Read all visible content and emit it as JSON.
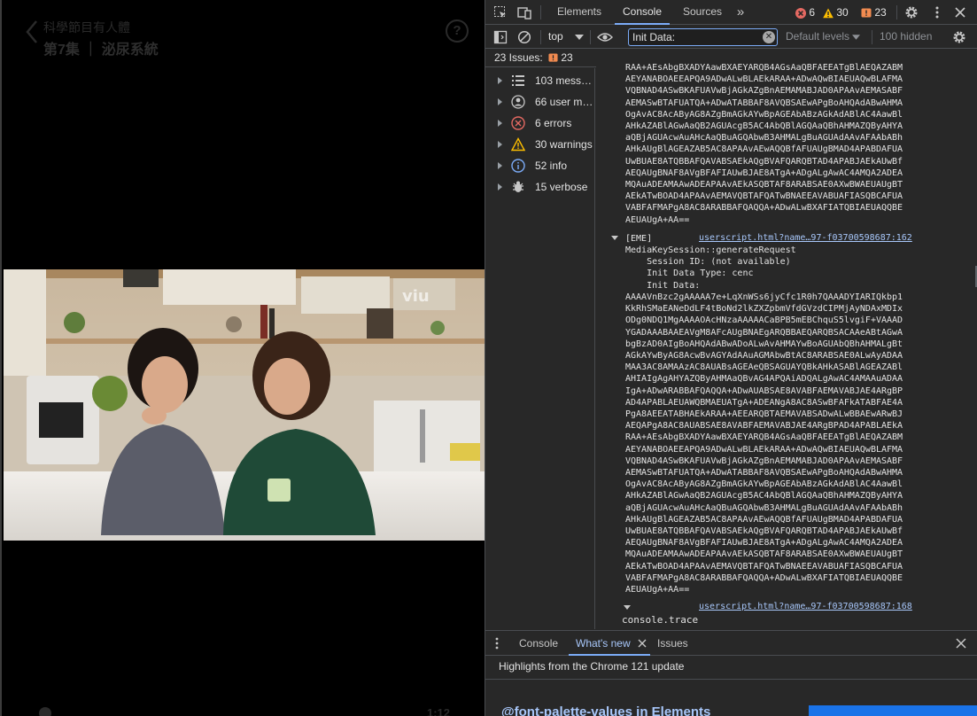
{
  "player": {
    "show_title": "科學節目有人體",
    "episode_title": "第7集 ｜ 泌尿系統",
    "help_label": "?",
    "watermark": "viu",
    "time": "1:12"
  },
  "devtools": {
    "tabs": [
      "Elements",
      "Console",
      "Sources"
    ],
    "more_tabs": "»",
    "counts": {
      "errors": "6",
      "warnings": "30",
      "issues": "23"
    },
    "toolbar": {
      "context": "top",
      "filter_value": "Init Data:",
      "levels": "Default levels",
      "hidden": "100 hidden"
    },
    "issues_bar": {
      "label": "23 Issues:",
      "count": "23"
    },
    "sidebar": [
      {
        "label": "103 messa…",
        "icon": "list-icon"
      },
      {
        "label": "66 user me…",
        "icon": "user-icon"
      },
      {
        "label": "6 errors",
        "icon": "error-icon"
      },
      {
        "label": "30 warnings",
        "icon": "warning-icon"
      },
      {
        "label": "52 info",
        "icon": "info-icon"
      },
      {
        "label": "15 verbose",
        "icon": "bug-icon"
      }
    ],
    "console": {
      "prev_b64": "RAA+AEsAbgBXADYAawBXAEYARQB4AGsAaQBFAEEATgBlAEQAZABM\nAEYANABOAEEAPQA9ADwALwBLAEkARAA+ADwAQwBIAEUAQwBLAFMA\nVQBNAD4ASwBKAFUAVwBjAGkAZgBnAEMAMABJAD0APAAvAEMASABF\nAEMASwBTAFUATQA+ADwATABBAF8AVQBSAEwAPgBoAHQAdABwAHMA\nOgAvAC8AcAByAG8AZgBmAGkAYwBpAGEAbABzAGkAdABlAC4AawBl\nAHkAZABlAGwAaQB2AGUAcgB5AC4AbQBlAGQAaQBhAHMAZQByAHYA\naQBjAGUAcwAuAHcAaQBuAGQAbwB3AHMALgBuAGUAdAAvAFAAbABh\nAHkAUgBlAGEAZAB5AC8APAAvAEwAQQBfAFUAUgBMAD4APABDAFUA\nUwBUAE8ATQBBAFQAVABSAEkAQgBVAFQARQBTAD4APABJAEkAUwBf\nAEQAUgBNAF8AVgBFAFIAUwBJAE8ATgA+ADgALgAwAC4AMQA2ADEA\nMQAuADEAMAAwADEAPAAvAEkASQBTAF8ARABSAE0AXwBWAEUAUgBT\nAEkATwBOAD4APAAvAEMAVQBTAFQATwBNAEEAVABUAFIASQBCAFUA\nVABFAFMAPgA8AC8ARABBAFQAQQA+ADwALwBXAFIATQBIAEUAQQBE\nAEUAUgA+AA==",
      "eme_tag": "[EME]",
      "link1": "userscript.html?name…97-f03700598687:162",
      "eme_lines": "MediaKeySession::generateRequest\n    Session ID: (not available)\n    Init Data Type: cenc\n    Init Data:",
      "init_b64": "AAAAVnBzc2gAAAAA7e+LqXnWSs6jyCfc1R0h7QAAADYIARIQkbp1\nKkRhSMaEANeDdLF4tBoNd2lkZXZpbmVfdGVzdCIPMjAyNDAxMDIx\nODg0NDQ1MgAAAAOAcHNzaAAAAACaBPB5mEBChquS5lvgiF+VAAAD\nYGADAAABAAEAVgM8AFcAUgBNAEgARQBBAEQARQBSACAAeABtAGwA\nbgBzAD0AIgBoAHQAdABwADoALwAvAHMAYwBoAGUAbQBhAHMALgBt\nAGkAYwByAG8AcwBvAGYAdAAuAGMAbwBtAC8ARABSAE0ALwAyADAA\nMAA3AC8AMAAzAC8AUABsAGEAeQBSAGUAYQBkAHkASABlAGEAZABl\nAHIAIgAgAHYAZQByAHMAaQBvAG4APQAiADQALgAwAC4AMAAuADAA\nIgA+ADwARABBAFQAQQA+ADwAUABSAE8AVABFAEMAVABJAE4ARgBP\nAD4APABLAEUAWQBMAEUATgA+ADEANgA8AC8ASwBFAFkATABFAE4A\nPgA8AEEATABHAEkARAA+AEEARQBTAEMAVABSADwALwBBAEwARwBJ\nAEQAPgA8AC8AUABSAE8AVABFAEMAVABJAE4ARgBPAD4APABLAEkA\nRAA+AEsAbgBXADYAawBXAEYARQB4AGsAaQBFAEEATgBlAEQAZABM\nAEYANABOAEEAPQA9ADwALwBLAEkARAA+ADwAQwBIAEUAQwBLAFMA\nVQBNAD4ASwBKAFUAVwBjAGkAZgBnAEMAMABJAD0APAAvAEMASABF\nAEMASwBTAFUATQA+ADwATABBAF8AVQBSAEwAPgBoAHQAdABwAHMA\nOgAvAC8AcAByAG8AZgBmAGkAYwBpAGEAbABzAGkAdABlAC4AawBl\nAHkAZABlAGwAaQB2AGUAcgB5AC4AbQBlAGQAaQBhAHMAZQByAHYA\naQBjAGUAcwAuAHcAaQBuAGQAbwB3AHMALgBuAGUAdAAvAFAAbABh\nAHkAUgBlAGEAZAB5AC8APAAvAEwAQQBfAFUAUgBMAD4APABDAFUA\nUwBUAE8ATQBBAFQAVABSAEkAQgBVAFQARQBTAD4APABJAEkAUwBf\nAEQAUgBNAF8AVgBFAFIAUwBJAE8ATgA+ADgALgAwAC4AMQA2ADEA\nMQAuADEAMAAwADEAPAAvAEkASQBTAF8ARABSAE0AXwBWAEUAUgBT\nAEkATwBOAD4APAAvAEMAVQBTAFQATwBNAEEAVABUAFIASQBCAFUA\nVABFAFMAPgA8AC8ARABBAFQAQQA+ADwALwBXAFIATQBIAEUAQQBE\nAEUAUgA+AA==",
      "link2": "userscript.html?name…97-f03700598687:168",
      "trace": "console.trace"
    },
    "drawer": {
      "tabs": [
        "Console",
        "What's new",
        "Issues"
      ],
      "highlights": "Highlights from the Chrome 121 update",
      "feature_title": "@font-palette-values in Elements"
    },
    "colors": {
      "panel_bg": "#282828",
      "accent": "#7cacf8",
      "error": "#e46962",
      "warning": "#fcbd00",
      "info": "#7cacf8",
      "link": "#a8c7fa"
    }
  }
}
